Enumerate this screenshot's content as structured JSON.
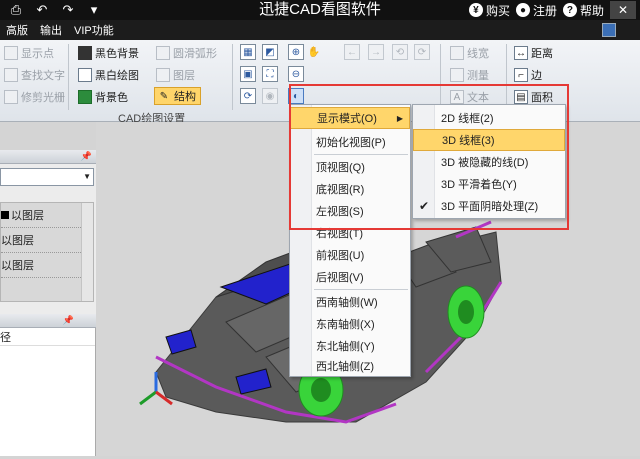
{
  "titlebar": {
    "title": "迅捷CAD看图软件",
    "buy": "购买",
    "register": "注册",
    "help": "帮助"
  },
  "menubar": {
    "items": [
      "高版",
      "输出",
      "VIP功能"
    ]
  },
  "ribbon": {
    "col1": [
      "显示点",
      "查找文字",
      "修剪光栅"
    ],
    "col2": [
      "黑色背景",
      "黑白绘图",
      "背景色"
    ],
    "col3": [
      "圆滑弧形",
      "图层",
      "结构"
    ],
    "group_label": "CAD绘图设置",
    "col5": [
      "线宽",
      "测量",
      "文本"
    ],
    "col6": [
      "距离",
      "边",
      "面积"
    ]
  },
  "leftpanel": {
    "rows": [
      "以图层",
      "以图层",
      "以图层"
    ],
    "pane2_row": "径"
  },
  "context_menu": {
    "items": [
      "显示模式(O)",
      "初始化视图(P)",
      "顶视图(Q)",
      "底视图(R)",
      "左视图(S)",
      "右视图(T)",
      "前视图(U)",
      "后视图(V)",
      "西南轴侧(W)",
      "东南轴侧(X)",
      "东北轴侧(Y)",
      "西北轴侧(Z)"
    ]
  },
  "submenu": {
    "items": [
      "2D 线框(2)",
      "3D 线框(3)",
      "3D 被隐藏的线(D)",
      "3D 平滑着色(Y)",
      "3D 平面阴暗处理(Z)"
    ],
    "checked_index": 4,
    "highlight_index": 1
  },
  "colors": {
    "highlight": "#ffd66b",
    "annotation_red": "#e53935",
    "car_body": "#5a5a5a",
    "car_trim": "#b236c4",
    "wheel": "#39d43a",
    "glass": "#2222cc"
  }
}
